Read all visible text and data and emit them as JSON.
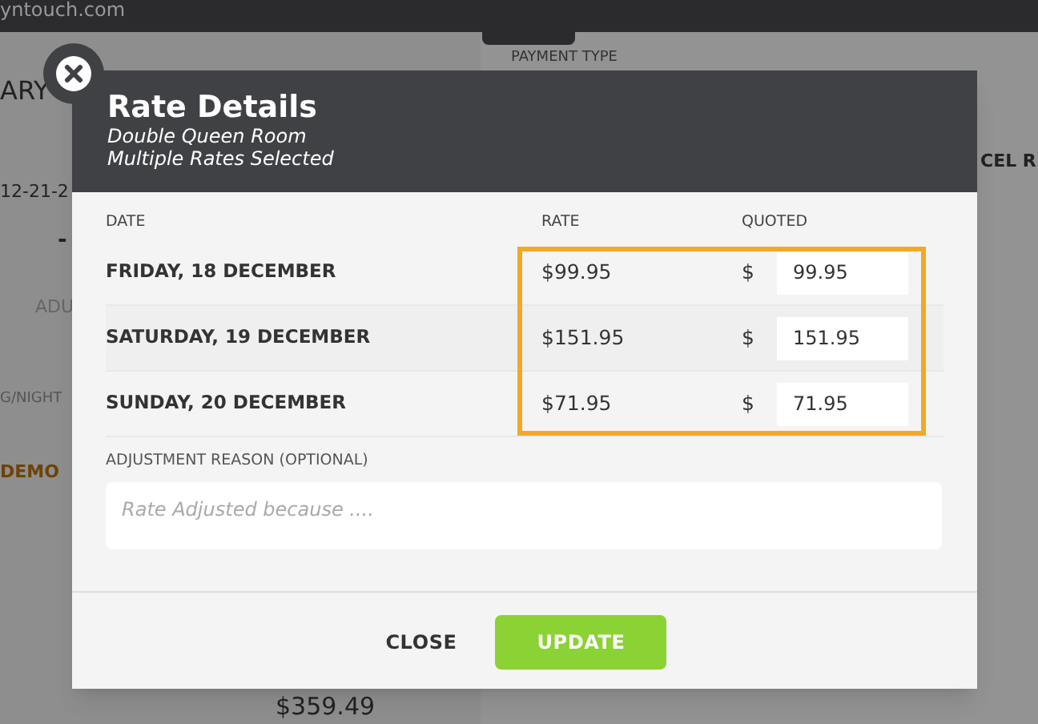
{
  "browser": {
    "url": "yntouch.com"
  },
  "background": {
    "left": [
      {
        "text": "ARY"
      },
      {
        "text": "12-21-2"
      },
      {
        "text": "-"
      },
      {
        "text": "ADU"
      },
      {
        "text": "G/NIGHT"
      },
      {
        "text": "DEMO"
      },
      {
        "text": "$359.49"
      }
    ],
    "right": [
      {
        "text": "PAYMENT TYPE"
      },
      {
        "text": "CEL R"
      }
    ]
  },
  "modal": {
    "title": "Rate Details",
    "subtitle_lines": [
      "Double Queen Room",
      "Multiple Rates Selected"
    ],
    "columns": [
      "DATE",
      "RATE",
      "QUOTED"
    ],
    "rows": [
      {
        "date": "FRIDAY, 18 DECEMBER",
        "rate": "$99.95",
        "currency": "$",
        "quoted": "99.95"
      },
      {
        "date": "SATURDAY, 19 DECEMBER",
        "rate": "$151.95",
        "currency": "$",
        "quoted": "151.95"
      },
      {
        "date": "SUNDAY, 20 DECEMBER",
        "rate": "$71.95",
        "currency": "$",
        "quoted": "71.95"
      }
    ],
    "reason": {
      "label": "ADJUSTMENT REASON (OPTIONAL)",
      "placeholder": "Rate Adjusted because ...."
    },
    "buttons": [
      {
        "label": "CLOSE",
        "kind": "text"
      },
      {
        "label": "UPDATE",
        "kind": "primary"
      }
    ]
  }
}
